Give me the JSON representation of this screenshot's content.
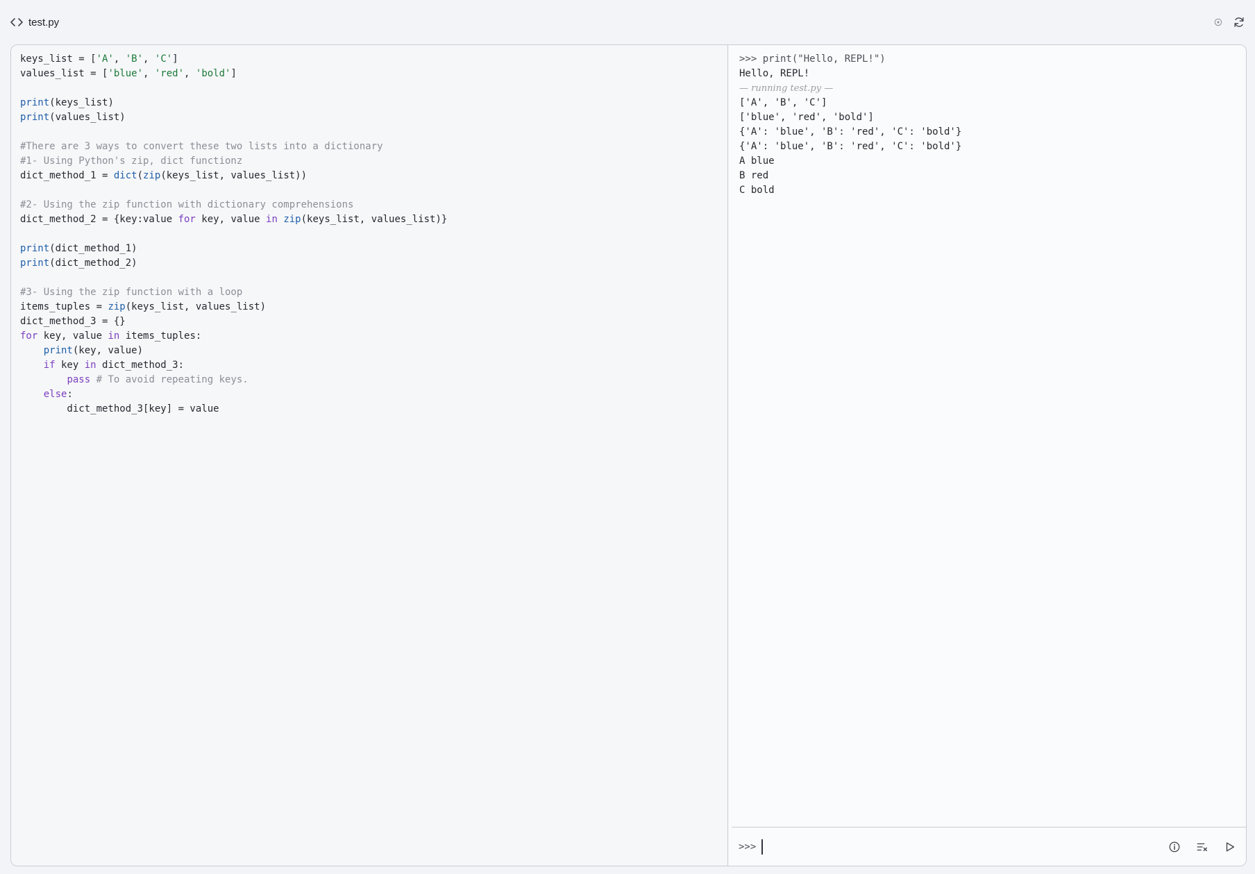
{
  "header": {
    "file_name": "test.py",
    "icons": [
      "code-icon",
      "circle-dot-icon",
      "refresh-icon"
    ]
  },
  "editor": {
    "lines": [
      [
        {
          "t": "keys_list = ["
        },
        {
          "t": "'A'",
          "c": "str"
        },
        {
          "t": ", "
        },
        {
          "t": "'B'",
          "c": "str"
        },
        {
          "t": ", "
        },
        {
          "t": "'C'",
          "c": "str"
        },
        {
          "t": "]"
        }
      ],
      [
        {
          "t": "values_list = ["
        },
        {
          "t": "'blue'",
          "c": "str"
        },
        {
          "t": ", "
        },
        {
          "t": "'red'",
          "c": "str"
        },
        {
          "t": ", "
        },
        {
          "t": "'bold'",
          "c": "str"
        },
        {
          "t": "]"
        }
      ],
      [],
      [
        {
          "t": "print",
          "c": "fn"
        },
        {
          "t": "(keys_list)"
        }
      ],
      [
        {
          "t": "print",
          "c": "fn"
        },
        {
          "t": "(values_list)"
        }
      ],
      [],
      [
        {
          "t": "#There are 3 ways to convert these two lists into a dictionary",
          "c": "com"
        }
      ],
      [
        {
          "t": "#1- Using Python's zip, dict functionz",
          "c": "com"
        }
      ],
      [
        {
          "t": "dict_method_1 = "
        },
        {
          "t": "dict",
          "c": "fn"
        },
        {
          "t": "("
        },
        {
          "t": "zip",
          "c": "fn"
        },
        {
          "t": "(keys_list, values_list))"
        }
      ],
      [],
      [
        {
          "t": "#2- Using the zip function with dictionary comprehensions",
          "c": "com"
        }
      ],
      [
        {
          "t": "dict_method_2 = {key:value "
        },
        {
          "t": "for",
          "c": "kw"
        },
        {
          "t": " key, value "
        },
        {
          "t": "in",
          "c": "kw"
        },
        {
          "t": " "
        },
        {
          "t": "zip",
          "c": "fn"
        },
        {
          "t": "(keys_list, values_list)}"
        }
      ],
      [],
      [
        {
          "t": "print",
          "c": "fn"
        },
        {
          "t": "(dict_method_1)"
        }
      ],
      [
        {
          "t": "print",
          "c": "fn"
        },
        {
          "t": "(dict_method_2)"
        }
      ],
      [],
      [
        {
          "t": "#3- Using the zip function with a loop",
          "c": "com"
        }
      ],
      [
        {
          "t": "items_tuples = "
        },
        {
          "t": "zip",
          "c": "fn"
        },
        {
          "t": "(keys_list, values_list)"
        }
      ],
      [
        {
          "t": "dict_method_3 = {}"
        }
      ],
      [
        {
          "t": "for",
          "c": "kw"
        },
        {
          "t": " key, value "
        },
        {
          "t": "in",
          "c": "kw"
        },
        {
          "t": " items_tuples:"
        }
      ],
      [
        {
          "t": "    "
        },
        {
          "t": "print",
          "c": "fn"
        },
        {
          "t": "(key, value)"
        }
      ],
      [
        {
          "t": "    "
        },
        {
          "t": "if",
          "c": "kw"
        },
        {
          "t": " key "
        },
        {
          "t": "in",
          "c": "kw"
        },
        {
          "t": " dict_method_3:"
        }
      ],
      [
        {
          "t": "        "
        },
        {
          "t": "pass",
          "c": "kw"
        },
        {
          "t": " "
        },
        {
          "t": "# To avoid repeating keys.",
          "c": "com"
        }
      ],
      [
        {
          "t": "    "
        },
        {
          "t": "else",
          "c": "kw"
        },
        {
          "t": ":"
        }
      ],
      [
        {
          "t": "        dict_method_3[key] = value"
        }
      ]
    ]
  },
  "repl": {
    "output": [
      {
        "text": ">>> print(\"Hello, REPL!\")",
        "kind": "cmd"
      },
      {
        "text": "Hello, REPL!",
        "kind": "out"
      },
      {
        "text": "— running test.py —",
        "kind": "note"
      },
      {
        "text": "['A', 'B', 'C']",
        "kind": "out"
      },
      {
        "text": "['blue', 'red', 'bold']",
        "kind": "out"
      },
      {
        "text": "{'A': 'blue', 'B': 'red', 'C': 'bold'}",
        "kind": "out"
      },
      {
        "text": "{'A': 'blue', 'B': 'red', 'C': 'bold'}",
        "kind": "out"
      },
      {
        "text": "A blue",
        "kind": "out"
      },
      {
        "text": "B red",
        "kind": "out"
      },
      {
        "text": "C bold",
        "kind": "out"
      }
    ],
    "prompt": ">>>",
    "input_value": "",
    "actions": [
      "info-icon",
      "clear-output-icon",
      "run-icon"
    ]
  }
}
